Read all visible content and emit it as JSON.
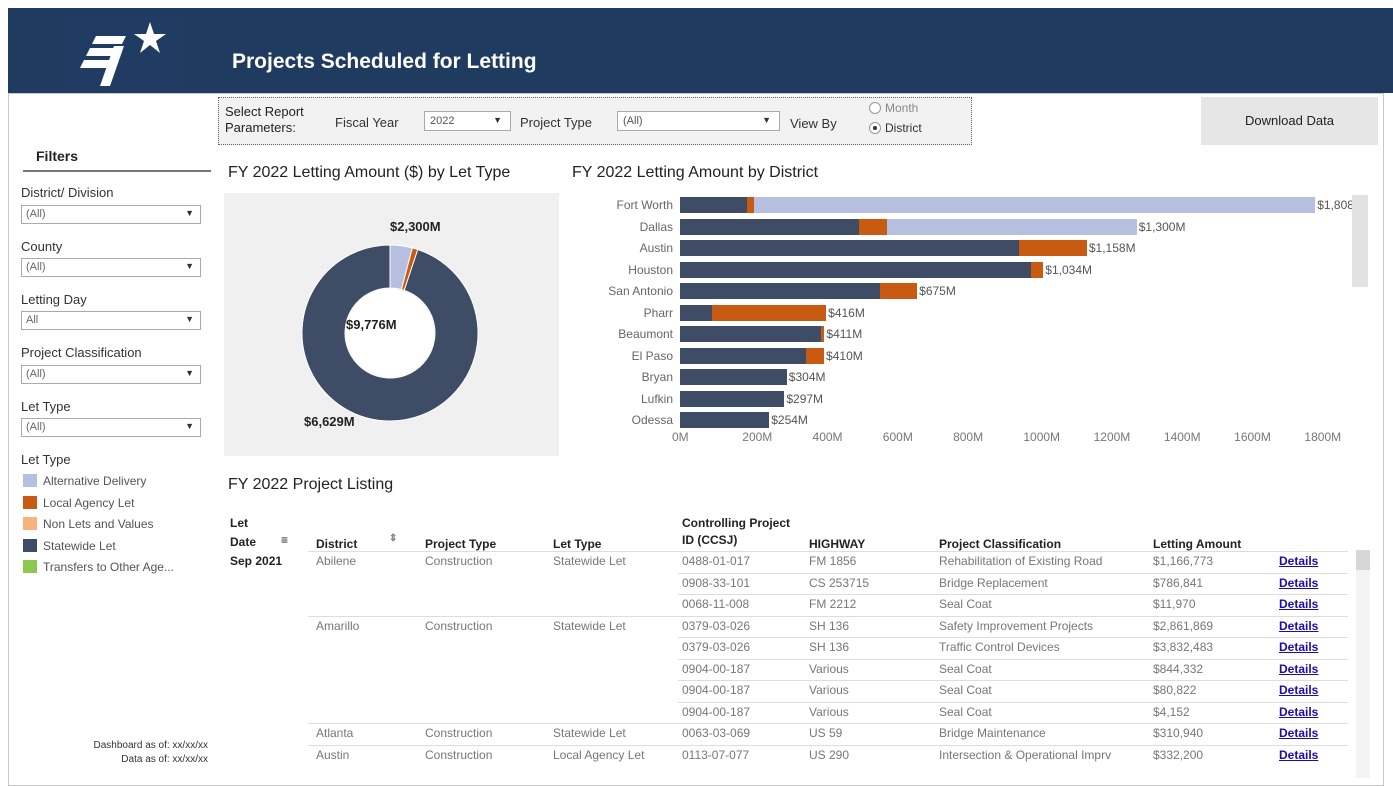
{
  "header": {
    "title": "Projects Scheduled for Letting"
  },
  "params": {
    "label": "Select Report Parameters:",
    "fiscal_year_label": "Fiscal Year",
    "fiscal_year_value": "2022",
    "project_type_label": "Project Type",
    "project_type_value": "(All)",
    "view_by_label": "View By",
    "view_by_options": [
      "Month",
      "District"
    ],
    "view_by_selected": "District"
  },
  "download_label": "Download Data",
  "filters": {
    "title": "Filters",
    "items": [
      {
        "label": "District/ Division",
        "value": "(All)"
      },
      {
        "label": "County",
        "value": "(All)"
      },
      {
        "label": "Letting Day",
        "value": "All"
      },
      {
        "label": "Project Classification",
        "value": "(All)"
      },
      {
        "label": "Let Type",
        "value": "(All)"
      }
    ],
    "legend_title": "Let Type",
    "legend": [
      {
        "label": "Alternative Delivery",
        "color": "#b7bfe0"
      },
      {
        "label": "Local Agency Let",
        "color": "#c95a12"
      },
      {
        "label": "Non Lets and Values",
        "color": "#f6b27f"
      },
      {
        "label": "Statewide Let",
        "color": "#3f4c66"
      },
      {
        "label": "Transfers to Other Age...",
        "color": "#8cc850"
      }
    ],
    "dashboard_as_of": "Dashboard as of: xx/xx/xx",
    "data_as_of": "Data as of: xx/xx/xx"
  },
  "donut": {
    "title": "FY 2022 Letting Amount ($) by Let Type",
    "center": "$9,776M",
    "top_label": "$2,300M",
    "bottom_label": "$6,629M"
  },
  "bars_title": "FY 2022  Letting Amount by District",
  "chart_data": [
    {
      "type": "pie",
      "title": "FY 2022 Letting Amount ($) by Let Type",
      "center_label": "$9,776M",
      "categories": [
        "Alternative Delivery",
        "Local Agency Let",
        "Statewide Let"
      ],
      "values": [
        400,
        100,
        9276
      ],
      "data_labels": [
        "$2,300M",
        "$6,629M"
      ]
    },
    {
      "type": "bar",
      "title": "FY 2022  Letting Amount by District",
      "orientation": "horizontal",
      "stacked": true,
      "categories": [
        "Fort Worth",
        "Dallas",
        "Austin",
        "Houston",
        "San Antonio",
        "Pharr",
        "Beaumont",
        "El Paso",
        "Bryan",
        "Lufkin",
        "Odessa"
      ],
      "series": [
        {
          "name": "Statewide Let",
          "values": [
            190,
            510,
            965,
            1000,
            570,
            90,
            400,
            360,
            304,
            297,
            254
          ]
        },
        {
          "name": "Local Agency Let",
          "values": [
            20,
            80,
            193,
            34,
            105,
            326,
            11,
            50,
            0,
            0,
            0
          ]
        },
        {
          "name": "Alternative Delivery",
          "values": [
            1598,
            710,
            0,
            0,
            0,
            0,
            0,
            0,
            0,
            0,
            0
          ]
        }
      ],
      "totals": [
        "$1,808M",
        "$1,300M",
        "$1,158M",
        "$1,034M",
        "$675M",
        "$416M",
        "$411M",
        "$410M",
        "$304M",
        "$297M",
        "$254M"
      ],
      "xlim": [
        0,
        1850
      ],
      "x_ticks": [
        "0M",
        "200M",
        "400M",
        "600M",
        "800M",
        "1000M",
        "1200M",
        "1400M",
        "1600M",
        "1800M"
      ]
    }
  ],
  "listing": {
    "title": "FY 2022 Project Listing",
    "headers": {
      "let_date": [
        "Let",
        "Date"
      ],
      "district": "District",
      "project_type": "Project Type",
      "let_type": "Let Type",
      "ccsj": [
        "Controlling Project",
        "ID (CCSJ)"
      ],
      "highway": "HIGHWAY",
      "classification": "Project Classification",
      "amount": "Letting Amount"
    },
    "rows": [
      {
        "date": "Sep 2021",
        "district": "Abilene",
        "ptype": "Construction",
        "ltype": "Statewide Let",
        "ccsj": "0488-01-017",
        "hwy": "FM 1856",
        "cls": "Rehabilitation of Existing Road",
        "amt": "$1,166,773",
        "link": "Details"
      },
      {
        "date": "",
        "district": "",
        "ptype": "",
        "ltype": "",
        "ccsj": "0908-33-101",
        "hwy": "CS 253715",
        "cls": "Bridge Replacement",
        "amt": "$786,841",
        "link": "Details"
      },
      {
        "date": "",
        "district": "",
        "ptype": "",
        "ltype": "",
        "ccsj": "0068-11-008",
        "hwy": "FM 2212",
        "cls": "Seal Coat",
        "amt": "$11,970",
        "link": "Details"
      },
      {
        "date": "",
        "district": "Amarillo",
        "ptype": "Construction",
        "ltype": "Statewide Let",
        "ccsj": "0379-03-026",
        "hwy": "SH 136",
        "cls": "Safety Improvement Projects",
        "amt": "$2,861,869",
        "link": "Details"
      },
      {
        "date": "",
        "district": "",
        "ptype": "",
        "ltype": "",
        "ccsj": "0379-03-026",
        "hwy": "SH 136",
        "cls": "Traffic Control Devices",
        "amt": "$3,832,483",
        "link": "Details"
      },
      {
        "date": "",
        "district": "",
        "ptype": "",
        "ltype": "",
        "ccsj": "0904-00-187",
        "hwy": "Various",
        "cls": "Seal Coat",
        "amt": "$844,332",
        "link": "Details"
      },
      {
        "date": "",
        "district": "",
        "ptype": "",
        "ltype": "",
        "ccsj": "0904-00-187",
        "hwy": "Various",
        "cls": "Seal Coat",
        "amt": "$80,822",
        "link": "Details"
      },
      {
        "date": "",
        "district": "",
        "ptype": "",
        "ltype": "",
        "ccsj": "0904-00-187",
        "hwy": "Various",
        "cls": "Seal Coat",
        "amt": "$4,152",
        "link": "Details"
      },
      {
        "date": "",
        "district": "Atlanta",
        "ptype": "Construction",
        "ltype": "Statewide Let",
        "ccsj": "0063-03-069",
        "hwy": "US 59",
        "cls": "Bridge Maintenance",
        "amt": "$310,940",
        "link": "Details"
      },
      {
        "date": "",
        "district": "Austin",
        "ptype": "Construction",
        "ltype": "Local Agency Let",
        "ccsj": "0113-07-077",
        "hwy": "US 290",
        "cls": "Intersection & Operational Imprv",
        "amt": "$332,200",
        "link": "Details"
      }
    ]
  }
}
